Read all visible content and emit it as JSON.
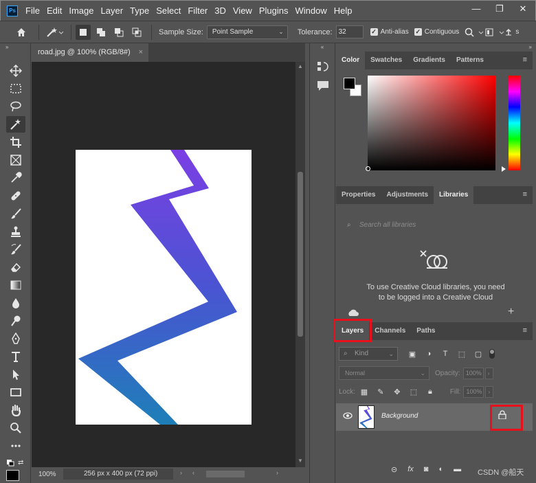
{
  "menubar": {
    "logo": "Ps",
    "items": [
      "File",
      "Edit",
      "Image",
      "Layer",
      "Type",
      "Select",
      "Filter",
      "3D",
      "View",
      "Plugins",
      "Window",
      "Help"
    ],
    "window_controls": [
      "—",
      "❐",
      "✕"
    ]
  },
  "options": {
    "sample_size_label": "Sample Size:",
    "sample_size_value": "Point Sample",
    "tolerance_label": "Tolerance:",
    "tolerance_value": "32",
    "anti_alias_label": "Anti-alias",
    "anti_alias_checked": true,
    "contiguous_label": "Contiguous",
    "contiguous_checked": true,
    "truncated_label": "s"
  },
  "document": {
    "tab_title": "road.jpg @ 100% (RGB/8#)",
    "close_glyph": "×"
  },
  "status": {
    "zoom": "100%",
    "doc_info": "256 px x 400 px (72 ppi)"
  },
  "panels": {
    "color_tabs": [
      "Color",
      "Swatches",
      "Gradients",
      "Patterns"
    ],
    "color_active": "Color",
    "lib_tabs": [
      "Properties",
      "Adjustments",
      "Libraries"
    ],
    "lib_active": "Libraries",
    "lib_search_placeholder": "Search all libraries",
    "lib_message_line1": "To use Creative Cloud libraries, you need",
    "lib_message_line2": "to be logged into a Creative Cloud",
    "layer_tabs": [
      "Layers",
      "Channels",
      "Paths"
    ],
    "layer_active": "Layers",
    "kind_label": "Kind",
    "blend_mode": "Normal",
    "opacity_label": "Opacity:",
    "opacity_value": "100%",
    "lock_label": "Lock:",
    "fill_label": "Fill:",
    "fill_value": "100%",
    "layer_name": "Background",
    "footer_icons": [
      "link-icon",
      "fx-icon",
      "mask-icon",
      "adjustment-icon",
      "group-icon"
    ],
    "watermark": "CSDN @船天"
  },
  "colors": {
    "accent_highlight": "#e8111b",
    "shape_top": "#7b3fe4",
    "shape_bottom": "#1e7fb8"
  }
}
